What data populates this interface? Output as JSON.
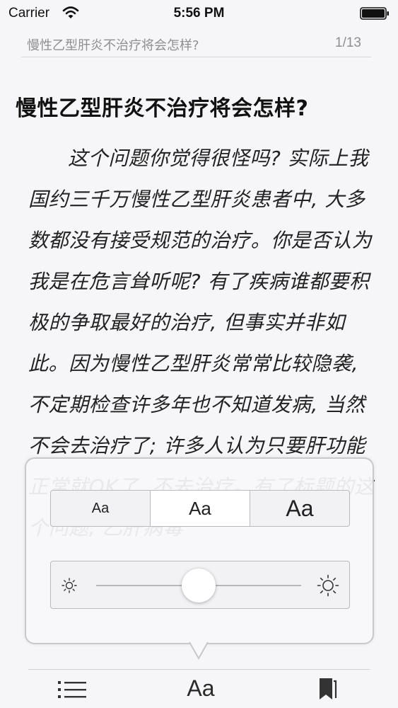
{
  "status_bar": {
    "carrier": "Carrier",
    "time": "5:56 PM",
    "icons": [
      "wifi-icon",
      "battery-icon"
    ]
  },
  "header": {
    "running_title": "慢性乙型肝炎不治疗将会怎样?",
    "page_counter": "1/13"
  },
  "article": {
    "title": "慢性乙型肝炎不治疗将会怎样?",
    "body": "这个问题你觉得很怪吗? 实际上我国约三千万慢性乙型肝炎患者中, 大多数都没有接受规范的治疗。你是否认为我是在危言耸听呢? 有了疾病谁都要积极的争取最好的治疗, 但事实并非如此。因为慢性乙型肝炎常常比较隐袭, 不定期检查许多年也不知道发病, 当然不会去治疗了; 许多人认为只要肝功能正常就OK了, 不去治疗。有了标题的这个问题, 乙肝病毒"
  },
  "font_popover": {
    "size_options": [
      {
        "label": "Aa",
        "selected": false
      },
      {
        "label": "Aa",
        "selected": true
      },
      {
        "label": "Aa",
        "selected": false
      }
    ],
    "brightness": 0.5,
    "icons": [
      "sun-small-icon",
      "sun-large-icon"
    ]
  },
  "toolbar": {
    "font_label": "Aa",
    "icons": [
      "toc-icon",
      "bookmark-icon"
    ]
  }
}
